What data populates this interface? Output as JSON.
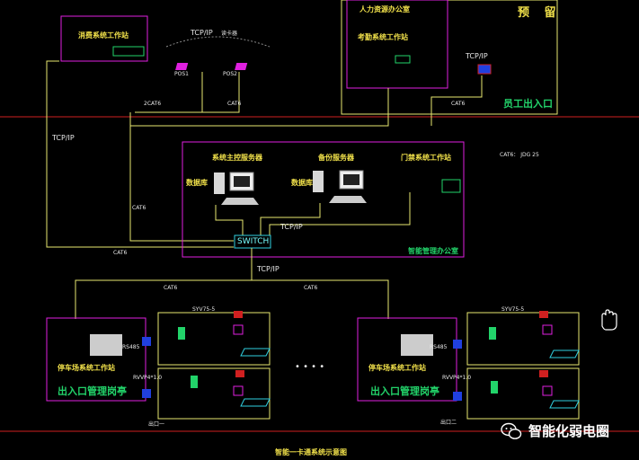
{
  "labels": {
    "fire_station": "消费系统工作站",
    "hr_office": "人力资源办公室",
    "reserved": "预  留",
    "attendance_station": "考勤系统工作站",
    "tcpip_top": "TCP/IP",
    "reader_top": "读卡器",
    "pos1": "POS1",
    "pos2": "POS2",
    "cat6_2": "2CAT6",
    "cat6_b": "CAT6",
    "tcpip_right": "TCP/IP",
    "cat6_right": "CAT6",
    "staff_gate": "员工出入口",
    "tcpip_left": "TCP/IP",
    "server_main": "系统主控服务器",
    "server_backup": "备份服务器",
    "door_station": "门禁系统工作站",
    "db_left": "数据库",
    "db_right": "数据库",
    "cat6_note": "CAT6：     JDG 25",
    "cat6_mid": "CAT6",
    "cat6_sw": "CAT6",
    "tcpip_sw": "TCP/IP",
    "switch": "SWITCH",
    "control_room": "智能管理办公室",
    "tcpip_down": "TCP/IP",
    "cat6_l": "CAT6",
    "cat6_r": "CAT6",
    "syv_left": "SYV75-5",
    "syv_right": "SYV75-5",
    "rs485_left": "RS485",
    "rs485_right": "RS485",
    "rvvp_left": "RVVP4*1.0",
    "rvvp_right": "RVVP4*1.0",
    "gate_station_left": "停车场系统工作站",
    "gate_station_right": "停车场系统工作站",
    "entry_left": "出入口管理岗亭",
    "entry_right": "出入口管理岗亭",
    "dots": "• • • •",
    "lane1": "出口一",
    "lane2": "出口二",
    "title": "智能一卡通系统示意图",
    "watermark": "智能化弱电圈"
  },
  "icons": {
    "hand": "hand-cursor-icon",
    "wechat": "wechat-logo-icon",
    "computer": "computer-workstation-icon",
    "pos": "pos-terminal-icon",
    "reader": "card-reader-icon",
    "camera": "camera-icon",
    "barrier": "barrier-gate-icon"
  },
  "colors": {
    "background": "#000000",
    "magenta": "#e020e0",
    "yellow_line": "#e8e870",
    "red_line": "#d02020",
    "cyan": "#30d0e0",
    "green_text": "#22d36a"
  }
}
